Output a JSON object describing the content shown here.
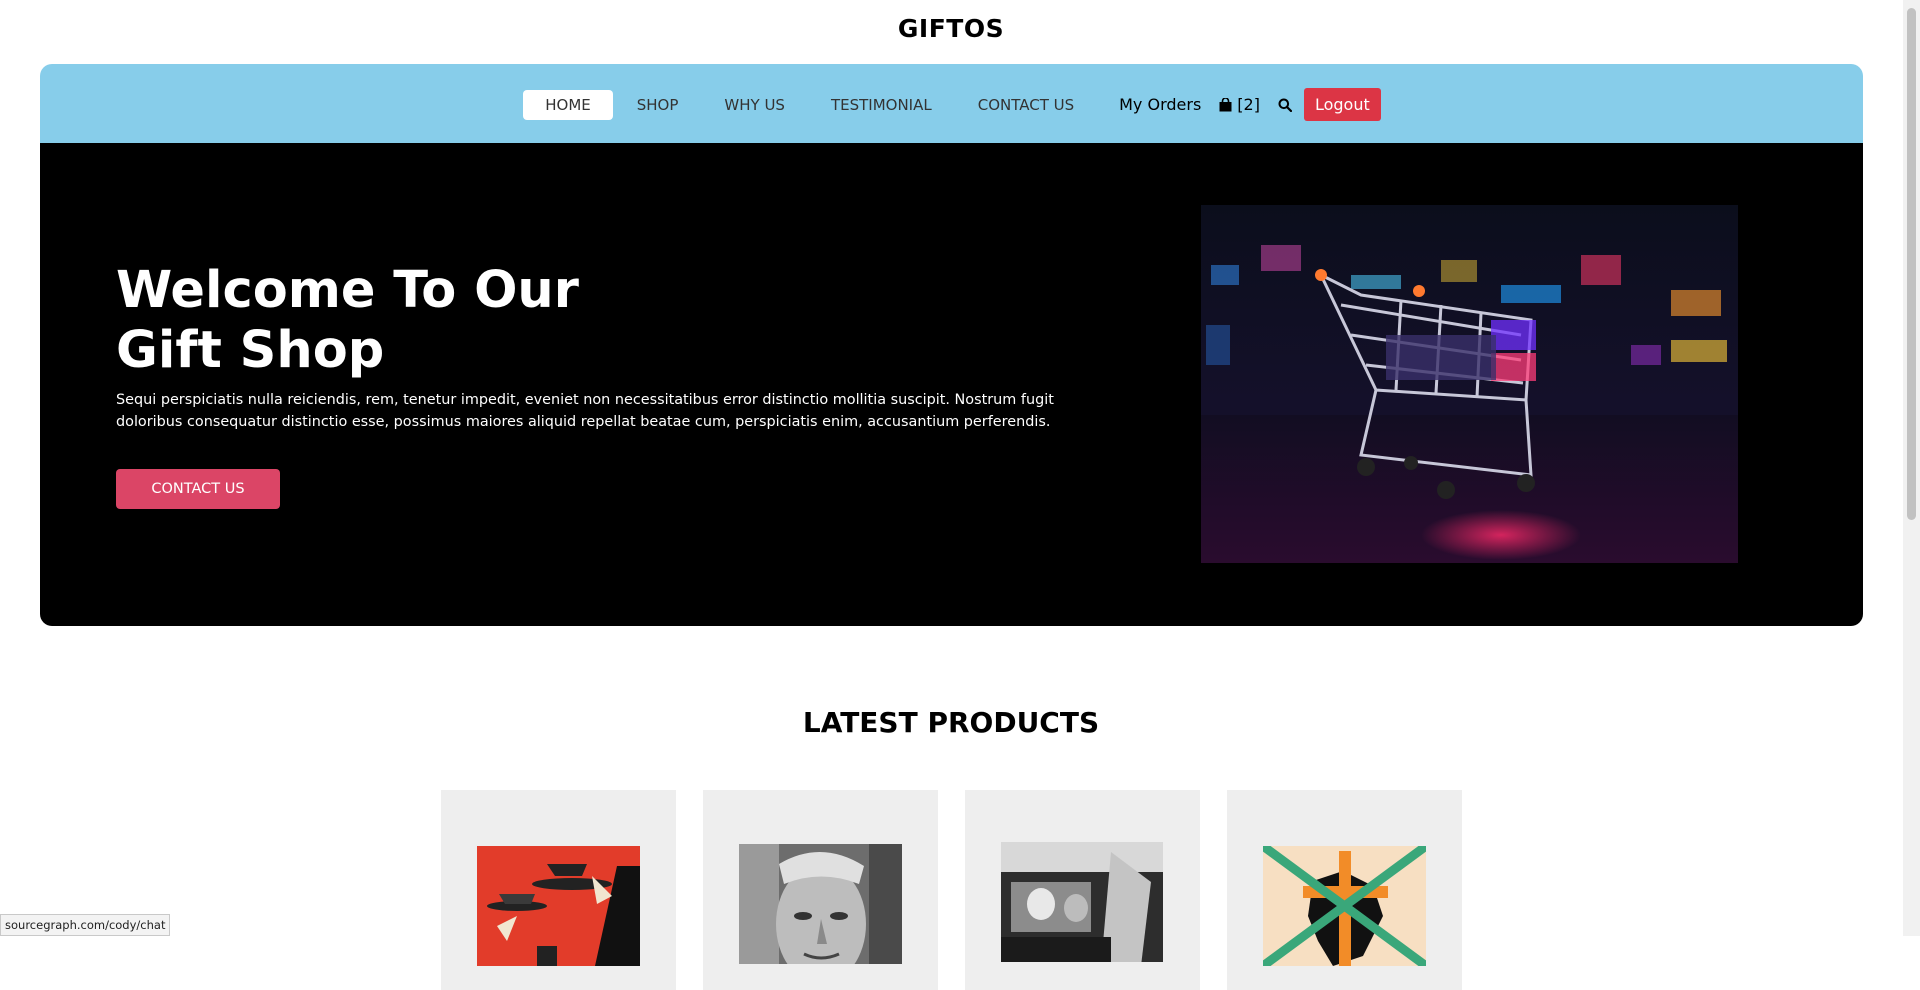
{
  "brand": "GIFTOS",
  "nav": {
    "links": [
      {
        "label": "HOME"
      },
      {
        "label": "SHOP"
      },
      {
        "label": "WHY US"
      },
      {
        "label": "TESTIMONIAL"
      },
      {
        "label": "CONTACT US"
      }
    ],
    "active_index": 0,
    "orders_label": "My Orders",
    "cart_count": "[2]",
    "logout_label": "Logout"
  },
  "hero": {
    "title_line1": "Welcome To Our",
    "title_line2": "Gift Shop",
    "text": "Sequi perspiciatis nulla reiciendis, rem, tenetur impedit, eveniet non necessitatibus error distinctio mollitia suscipit. Nostrum fugit doloribus consequatur distinctio esse, possimus maiores aliquid repellat beatae cum, perspiciatis enim, accusantium perferendis.",
    "button_label": "CONTACT US"
  },
  "latest_products": {
    "title": "LATEST PRODUCTS",
    "items": [
      {
        "image": "red-illustration"
      },
      {
        "image": "bw-portrait"
      },
      {
        "image": "bw-car-photo"
      },
      {
        "image": "crossed-map-poster"
      }
    ]
  },
  "status_bar": "sourcegraph.com/cody/chat",
  "colors": {
    "nav_bg": "#87cdea",
    "hero_bg": "#000000",
    "accent_pink": "#db4566",
    "logout_red": "#dc3545"
  }
}
